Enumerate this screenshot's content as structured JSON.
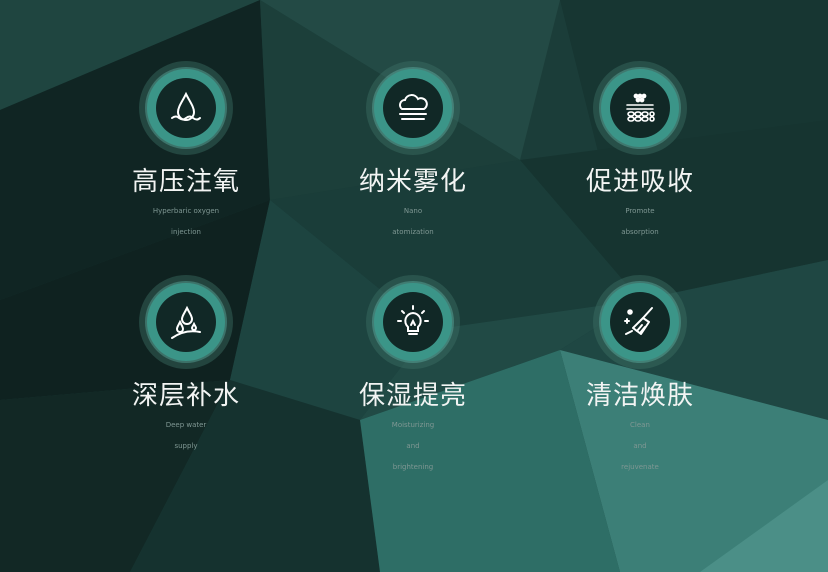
{
  "features": [
    {
      "title": "高压注氧",
      "lines": [
        "Hyperbaric oxygen",
        "injection"
      ],
      "icon": "water-drop-icon"
    },
    {
      "title": "纳米雾化",
      "lines": [
        "Nano",
        "atomization"
      ],
      "icon": "mist-cloud-icon"
    },
    {
      "title": "促进吸收",
      "lines": [
        "Promote",
        "absorption"
      ],
      "icon": "skin-layers-icon"
    },
    {
      "title": "深层补水",
      "lines": [
        "Deep water",
        "supply"
      ],
      "icon": "hydration-drops-icon"
    },
    {
      "title": "保湿提亮",
      "lines": [
        "Moisturizing",
        "and",
        "brightening"
      ],
      "icon": "light-bulb-icon"
    },
    {
      "title": "清洁焕肤",
      "lines": [
        "Clean",
        "and",
        "rejuvenate"
      ],
      "icon": "broom-sparkle-icon"
    }
  ],
  "colors": {
    "background": "#183a36",
    "accent": "#3b9588",
    "disc": "#112826",
    "title": "#f2f4f3",
    "subtitle": "#7f9793"
  }
}
